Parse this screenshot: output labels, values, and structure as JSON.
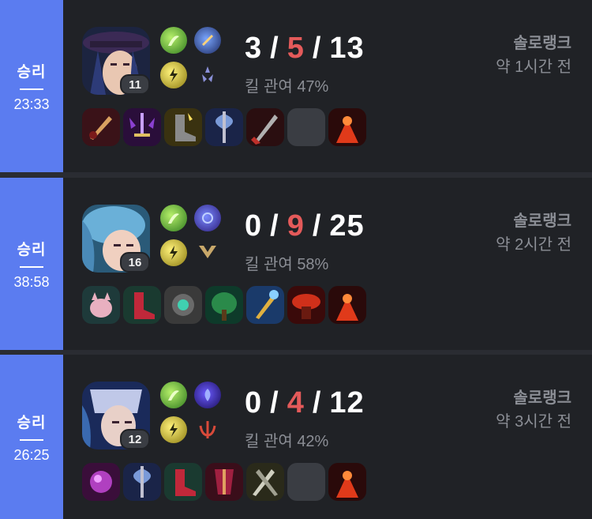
{
  "matches": [
    {
      "result": "승리",
      "duration": "23:33",
      "champion_icon": "champion-portrait-hat-gunslinger",
      "champion_level": "11",
      "kda": {
        "kills": "3",
        "deaths": "5",
        "assists": "13"
      },
      "kill_participation": "킬 관여 47%",
      "queue": "솔로랭크",
      "time_ago": "약 1시간 전",
      "items": [
        "item-blade-icon",
        "item-sword-icon",
        "item-boots-icon",
        "item-axe-icon",
        "item-dagger-icon",
        "empty",
        "item-trinket-icon"
      ]
    },
    {
      "result": "승리",
      "duration": "38:58",
      "champion_icon": "champion-portrait-blue-hair",
      "champion_level": "16",
      "kda": {
        "kills": "0",
        "deaths": "9",
        "assists": "25"
      },
      "kill_participation": "킬 관여 58%",
      "queue": "솔로랭크",
      "time_ago": "약 2시간 전",
      "items": [
        "item-cat-icon",
        "item-boots-icon",
        "item-eye-icon",
        "item-tree-icon",
        "item-wand-icon",
        "item-shield-icon",
        "item-trinket-icon"
      ]
    },
    {
      "result": "승리",
      "duration": "26:25",
      "champion_icon": "champion-portrait-silver-helm",
      "champion_level": "12",
      "kda": {
        "kills": "0",
        "deaths": "4",
        "assists": "12"
      },
      "kill_participation": "킬 관여 42%",
      "queue": "솔로랭크",
      "time_ago": "약 3시간 전",
      "items": [
        "item-orb-icon",
        "item-axe-icon",
        "item-boots-icon",
        "item-armor-icon",
        "item-blades-icon",
        "empty",
        "item-trinket-icon"
      ]
    }
  ],
  "colors": {
    "win_bar": "#5b7cf0",
    "card_bg": "#202226",
    "deaths": "#e45a5a",
    "muted_text": "#8b8e95"
  }
}
